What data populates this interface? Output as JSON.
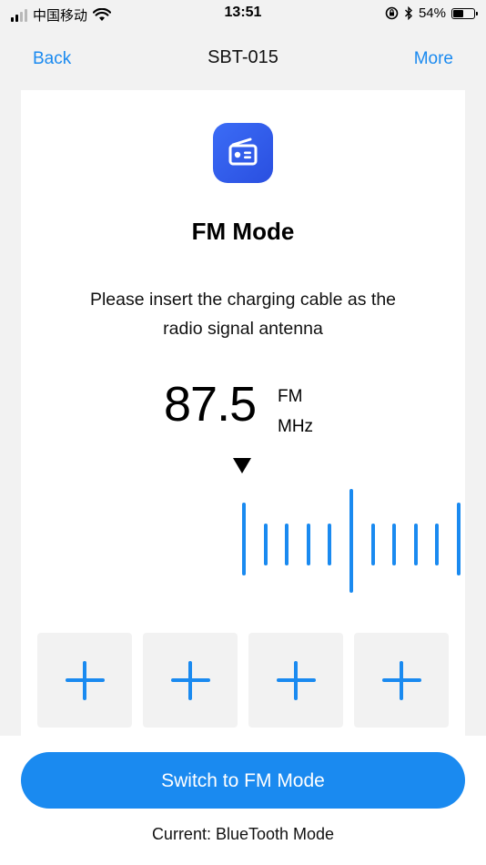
{
  "status_bar": {
    "carrier": "中国移动",
    "time": "13:51",
    "battery_percent": "54%",
    "battery_level": 0.54,
    "icons": [
      "signal-icon",
      "wifi-icon",
      "orientation-lock-icon",
      "bluetooth-icon",
      "battery-icon"
    ]
  },
  "nav": {
    "back_label": "Back",
    "title": "SBT-015",
    "more_label": "More"
  },
  "card": {
    "icon": "radio-icon",
    "mode_title": "FM Mode",
    "hint_line1": "Please insert the charging cable as the",
    "hint_line2": "radio signal antenna",
    "frequency": "87.5",
    "unit_band": "FM",
    "unit_freq": "MHz",
    "presets": [
      {
        "icon": "plus-icon"
      },
      {
        "icon": "plus-icon"
      },
      {
        "icon": "plus-icon"
      },
      {
        "icon": "plus-icon"
      }
    ]
  },
  "bottom": {
    "switch_label": "Switch to FM Mode",
    "current_label": "Current: BlueTooth Mode"
  },
  "colors": {
    "accent": "#1a8af0",
    "icon_bg": "#3b6cf6",
    "page_bg": "#f2f2f2"
  }
}
